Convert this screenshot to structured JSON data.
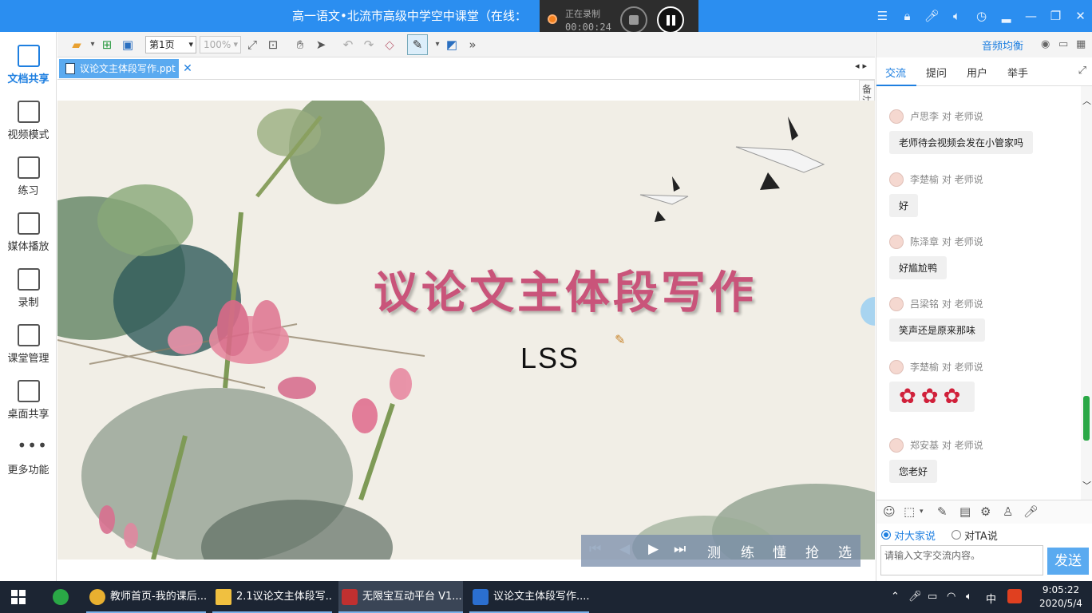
{
  "titlebar": {
    "title": "高一语文•北流市高级中学空中课堂（在线：",
    "recording_label": "正在录制",
    "recording_time": "00:00:24"
  },
  "sidebar": {
    "items": [
      {
        "label": "文档共享",
        "icon": "document-share-icon",
        "active": true
      },
      {
        "label": "视频模式",
        "icon": "video-mode-icon"
      },
      {
        "label": "练习",
        "icon": "exercise-icon"
      },
      {
        "label": "媒体播放",
        "icon": "media-play-icon"
      },
      {
        "label": "录制",
        "icon": "record-icon"
      },
      {
        "label": "课堂管理",
        "icon": "class-management-icon"
      },
      {
        "label": "桌面共享",
        "icon": "desktop-share-icon"
      },
      {
        "label": "更多功能",
        "icon": "more-icon"
      }
    ]
  },
  "toolbar": {
    "page_value": "第1页",
    "zoom_value": "100%"
  },
  "doc_tab": {
    "filename": "议论文主体段写作.ppt",
    "close": "✕"
  },
  "slide": {
    "title": "议论文主体段写作",
    "subtitle": "LSS",
    "notes_tab": "备注",
    "accent_color": "#c9547a"
  },
  "playbar": {
    "buttons": [
      "测",
      "练",
      "懂",
      "抢",
      "选"
    ]
  },
  "right_panel": {
    "equalizer": "音频均衡",
    "tabs": [
      "交流",
      "提问",
      "用户",
      "举手"
    ],
    "messages": [
      {
        "sender": "卢思李 对 老师说",
        "text": "老师待会视频会发在小管家吗"
      },
      {
        "sender": "李楚榆 对 老师说",
        "text": "好"
      },
      {
        "sender": "陈泽章 对 老师说",
        "text": "好尴尬鸭"
      },
      {
        "sender": "吕梁铭 对 老师说",
        "text": "笑声还是原来那味"
      },
      {
        "sender": "李楚榆 对 老师说",
        "text": "",
        "roses": 3
      },
      {
        "sender": "郑安基 对 老师说",
        "text": "您老好"
      }
    ],
    "radio_all": "对大家说",
    "radio_ta": "对TA说",
    "input_placeholder": "请输入文字交流内容。",
    "send": "发送"
  },
  "taskbar": {
    "apps": [
      {
        "label": "教师首页-我的课后...",
        "color": "#e8b030"
      },
      {
        "label": "2.1议论文主体段写...",
        "color": "#f0c040"
      },
      {
        "label": "无限宝互动平台 V1...",
        "color": "#c03030"
      },
      {
        "label": "议论文主体段写作....",
        "color": "#2b6fd0"
      }
    ],
    "ime": "中",
    "time": "9:05:22",
    "date": "2020/5/4"
  }
}
